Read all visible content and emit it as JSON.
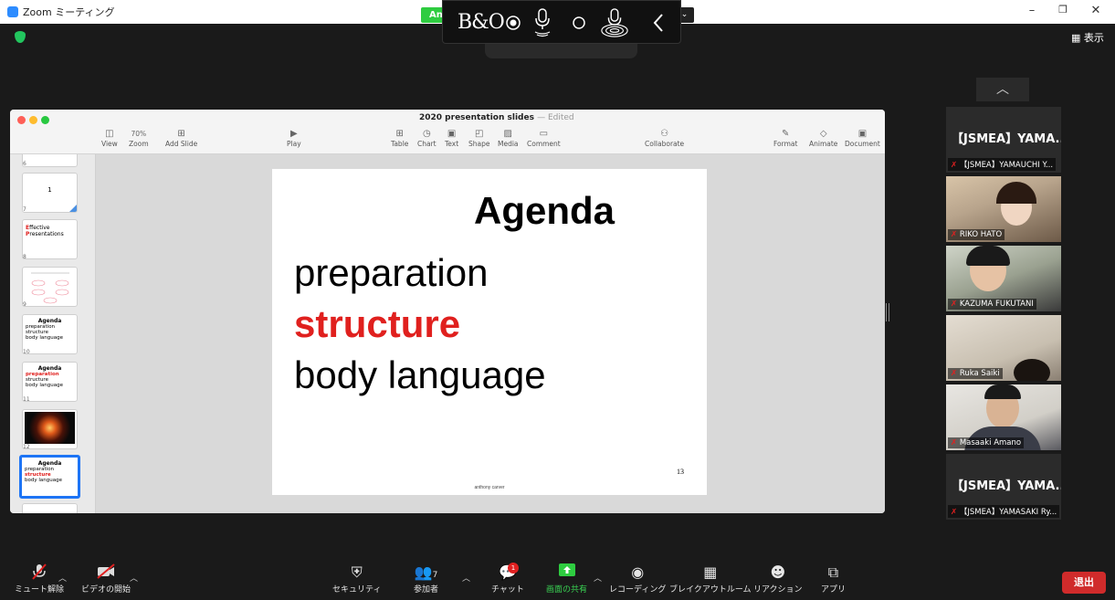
{
  "window": {
    "title": "Zoom ミーティング",
    "minimize": "–",
    "restore": "❐",
    "close": "✕"
  },
  "share_indicator": {
    "label": "An",
    "dropdown": "⌄"
  },
  "bo_toolbar": {
    "logo": "B&O"
  },
  "top_right": {
    "view_label": "表示"
  },
  "keynote": {
    "title": "2020 presentation slides",
    "status": "— Edited",
    "zoom": "70%",
    "toolbar": [
      {
        "label": "View",
        "icon": "sidebar-icon"
      },
      {
        "label": "Zoom",
        "icon": "zoom-icon"
      },
      {
        "label": "Add Slide",
        "icon": "add-slide-icon"
      },
      {
        "label": "Play",
        "icon": "play-icon"
      },
      {
        "label": "Table",
        "icon": "table-icon"
      },
      {
        "label": "Chart",
        "icon": "chart-icon"
      },
      {
        "label": "Text",
        "icon": "text-icon"
      },
      {
        "label": "Shape",
        "icon": "shape-icon"
      },
      {
        "label": "Media",
        "icon": "media-icon"
      },
      {
        "label": "Comment",
        "icon": "comment-icon"
      },
      {
        "label": "Collaborate",
        "icon": "collaborate-icon"
      },
      {
        "label": "Format",
        "icon": "format-icon"
      },
      {
        "label": "Animate",
        "icon": "animate-icon"
      },
      {
        "label": "Document",
        "icon": "document-icon"
      }
    ],
    "slides": [
      {
        "num": "6"
      },
      {
        "num": "7",
        "text": "1"
      },
      {
        "num": "8",
        "line1a": "E",
        "line1b": "ffective",
        "line2a": "P",
        "line2b": "resentations"
      },
      {
        "num": "9"
      },
      {
        "num": "10",
        "title": "Agenda",
        "items": [
          "preparation",
          "structure",
          "body language"
        ]
      },
      {
        "num": "11",
        "title": "Agenda",
        "items": [
          "preparation",
          "structure",
          "body language"
        ]
      },
      {
        "num": "12"
      },
      {
        "num": "13",
        "title": "Agenda",
        "items": [
          "preparation",
          "structure",
          "body language"
        ]
      }
    ],
    "current_slide": {
      "title": "Agenda",
      "items": [
        "preparation",
        "structure",
        "body language"
      ],
      "number": "13",
      "footer": "anthony carver"
    }
  },
  "participants": [
    {
      "big_name": "【JSMEA】YAMA...",
      "label": "【JSMEA】YAMAUCHI Y...",
      "video": false
    },
    {
      "label": "RIKO HATO",
      "video": true
    },
    {
      "label": "KAZUMA FUKUTANI",
      "video": true
    },
    {
      "label": "Ruka Saiki",
      "video": true
    },
    {
      "label": "Masaaki Amano",
      "video": true
    },
    {
      "big_name": "【JSMEA】YAMA...",
      "label": "【JSMEA】YAMASAKI Ry...",
      "video": false
    }
  ],
  "bottom_bar": {
    "mute": "ミュート解除",
    "video": "ビデオの開始",
    "security": "セキュリティ",
    "participants": "参加者",
    "participants_count": "7",
    "chat": "チャット",
    "chat_badge": "1",
    "share": "画面の共有",
    "record": "レコーディング",
    "breakout": "ブレイクアウトルーム",
    "reactions": "リアクション",
    "apps": "アプリ",
    "leave": "退出"
  },
  "colors": {
    "accent_blue": "#1d74f5",
    "zoom_blue": "#2d8cff",
    "share_green": "#2ecc40",
    "leave_red": "#d02b2b",
    "highlight_red": "#e0201e"
  }
}
